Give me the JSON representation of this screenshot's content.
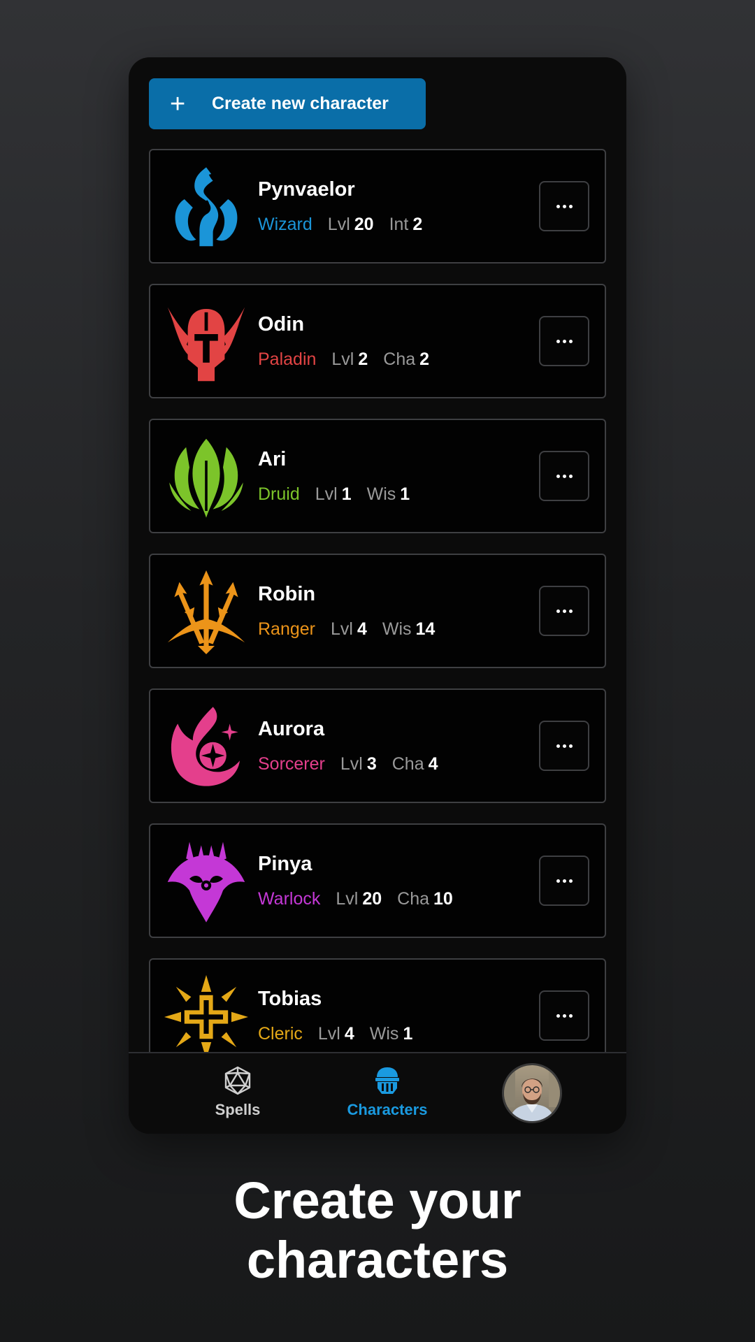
{
  "create_button": {
    "label": "Create new character"
  },
  "characters": [
    {
      "name": "Pynvaelor",
      "class": "Wizard",
      "level_label": "Lvl",
      "level": "20",
      "stat_label": "Int",
      "stat": "2",
      "color": "#1b95d8",
      "icon": "wizard-emblem-icon"
    },
    {
      "name": "Odin",
      "class": "Paladin",
      "level_label": "Lvl",
      "level": "2",
      "stat_label": "Cha",
      "stat": "2",
      "color": "#e24444",
      "icon": "paladin-helmet-icon"
    },
    {
      "name": "Ari",
      "class": "Druid",
      "level_label": "Lvl",
      "level": "1",
      "stat_label": "Wis",
      "stat": "1",
      "color": "#7cc42a",
      "icon": "druid-leaf-icon"
    },
    {
      "name": "Robin",
      "class": "Ranger",
      "level_label": "Lvl",
      "level": "4",
      "stat_label": "Wis",
      "stat": "14",
      "color": "#ec9419",
      "icon": "ranger-arrows-icon"
    },
    {
      "name": "Aurora",
      "class": "Sorcerer",
      "level_label": "Lvl",
      "level": "3",
      "stat_label": "Cha",
      "stat": "4",
      "color": "#e43f8c",
      "icon": "sorcerer-flame-icon"
    },
    {
      "name": "Pinya",
      "class": "Warlock",
      "level_label": "Lvl",
      "level": "20",
      "stat_label": "Cha",
      "stat": "10",
      "color": "#c438d6",
      "icon": "warlock-demon-icon"
    },
    {
      "name": "Tobias",
      "class": "Cleric",
      "level_label": "Lvl",
      "level": "4",
      "stat_label": "Wis",
      "stat": "1",
      "color": "#e4a817",
      "icon": "cleric-sun-icon"
    }
  ],
  "tabs": {
    "spells": {
      "label": "Spells",
      "icon": "d20-dice-icon"
    },
    "characters": {
      "label": "Characters",
      "icon": "knight-helmet-icon",
      "active": true
    },
    "profile": {
      "icon": "avatar"
    }
  },
  "headline": {
    "line1": "Create your",
    "line2": "characters"
  },
  "colors": {
    "accent": "#1a9ae0",
    "button": "#0a6ea8",
    "card_border": "#3e3f42"
  }
}
